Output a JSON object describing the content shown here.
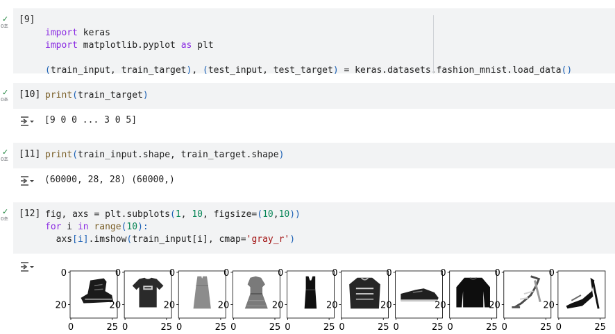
{
  "cells": [
    {
      "num": "[9]",
      "time": "0초",
      "code": {
        "l1_kw": "import",
        "l1_rest": " keras",
        "l2_kw": "import",
        "l2_mid": " matplotlib.pyplot ",
        "l2_kw2": "as",
        "l2_rest": " plt",
        "l4_p1": "(",
        "l4_a": "train_input, train_target",
        "l4_p2": ")",
        "l4_c": ", ",
        "l4_p3": "(",
        "l4_b": "test_input, test_target",
        "l4_p4": ")",
        "l4_rest": " = keras.datasets.fashion_mnist.load_data",
        "l4_p5": "()"
      }
    },
    {
      "num": "[10]",
      "time": "0초",
      "code": {
        "fn": "print",
        "p1": "(",
        "arg": "train_target",
        "p2": ")"
      },
      "output": "[9 0 0 ... 3 0 5]"
    },
    {
      "num": "[11]",
      "time": "0초",
      "code": {
        "fn": "print",
        "p1": "(",
        "arg": "train_input.shape, train_target.shape",
        "p2": ")"
      },
      "output": "(60000, 28, 28) (60000,)"
    },
    {
      "num": "[12]",
      "time": "0초",
      "code": {
        "l1_a": "fig, axs = plt.subplots",
        "l1_p1": "(",
        "l1_n1": "1",
        "l1_c1": ", ",
        "l1_n2": "10",
        "l1_c2": ", figsize=",
        "l1_p2": "(",
        "l1_n3": "10",
        "l1_c3": ",",
        "l1_n4": "10",
        "l1_p3": "))",
        "l2_kw": "for",
        "l2_mid": " i ",
        "l2_kw2": "in",
        "l2_fn": " range",
        "l2_p1": "(",
        "l2_n": "10",
        "l2_p2": "):",
        "l3_a": "  axs",
        "l3_b": "[i]",
        "l3_c": ".imshow",
        "l3_p1": "(",
        "l3_d": "train_input[i], cmap=",
        "l3_s": "'gray_r'",
        "l3_p2": ")"
      }
    }
  ],
  "figure": {
    "y_ticks": [
      "0",
      "20"
    ],
    "x_ticks": [
      "0",
      "25"
    ],
    "images": [
      "ankle-boot",
      "t-shirt",
      "dress",
      "dress",
      "dress",
      "pullover",
      "sneaker",
      "pullover",
      "sandal",
      "sandal"
    ]
  },
  "colors": {
    "check": "#188038",
    "cell_bg": "#f2f3f4",
    "keyword": "#8a2be2",
    "number": "#098658",
    "string": "#a31515"
  }
}
